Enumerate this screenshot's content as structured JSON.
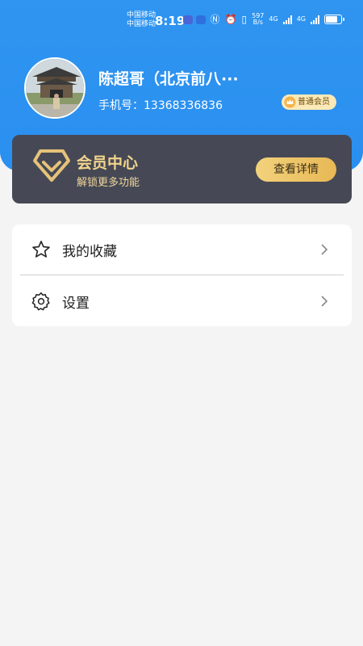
{
  "status_bar": {
    "carrier_1": "中国移动",
    "carrier_2": "中国移动",
    "time": "8:19",
    "net_speed_value": "597",
    "net_speed_unit": "B/s",
    "net_type_1": "4G",
    "net_type_2": "4G",
    "battery_level": 0.95
  },
  "profile": {
    "name": "陈超哥（北京前八···",
    "phone": "手机号：13368336836",
    "member_badge": "普通会员"
  },
  "member_card": {
    "title": "会员中心",
    "subtitle": "解锁更多功能",
    "button_label": "查看详情"
  },
  "menu": [
    {
      "label": "我的收藏",
      "icon": "star-icon"
    },
    {
      "label": "设置",
      "icon": "gear-icon"
    }
  ],
  "colors": {
    "header_blue": "#2f95f0",
    "card_dark": "#464955",
    "gold": "#f2d48a",
    "background": "#f4f4f4"
  }
}
